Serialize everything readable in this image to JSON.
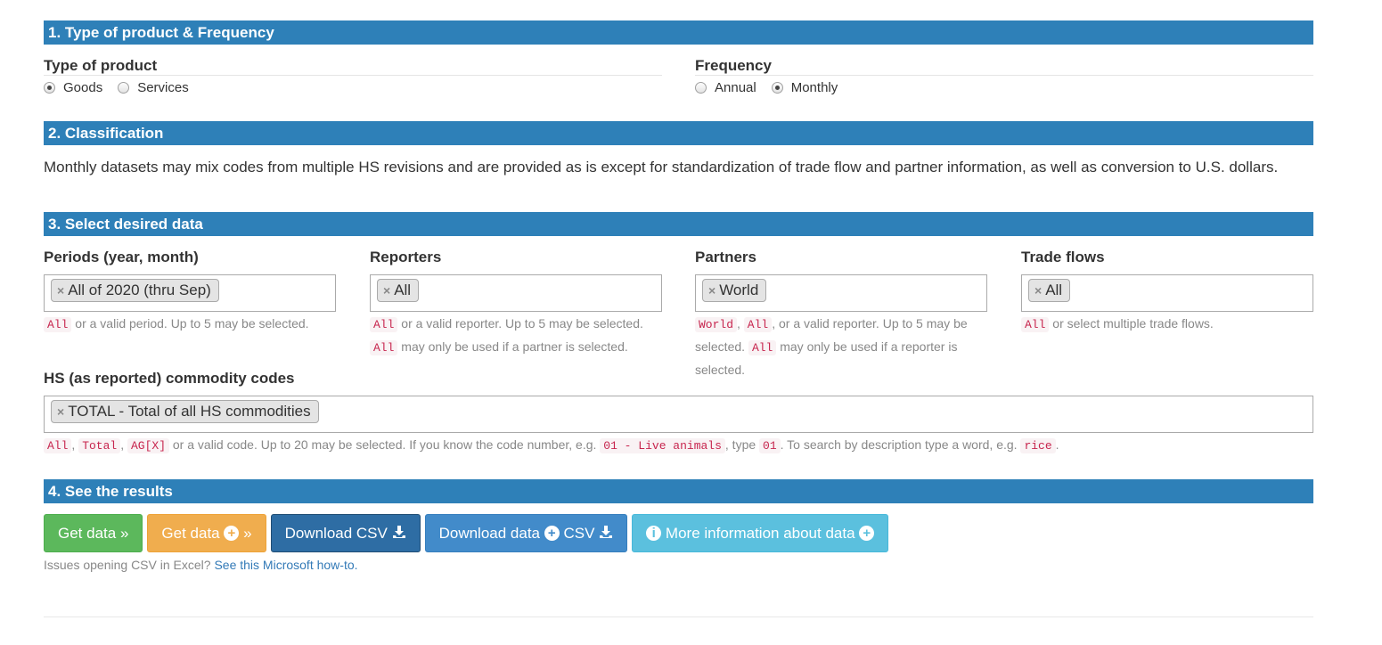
{
  "sections": {
    "s1": "1. Type of product & Frequency",
    "s2": "2. Classification",
    "s3": "3. Select desired data",
    "s4": "4. See the results"
  },
  "product_type": {
    "title": "Type of product",
    "options": [
      {
        "label": "Goods",
        "checked": true
      },
      {
        "label": "Services",
        "checked": false
      }
    ]
  },
  "frequency": {
    "title": "Frequency",
    "options": [
      {
        "label": "Annual",
        "checked": false
      },
      {
        "label": "Monthly",
        "checked": true
      }
    ]
  },
  "classification": {
    "description": "Monthly datasets may mix codes from multiple HS revisions and are provided as is except for standardization of trade flow and partner information, as well as conversion to U.S. dollars."
  },
  "filters": {
    "periods": {
      "label": "Periods (year, month)",
      "tag": "All of 2020 (thru Sep)",
      "help": {
        "c1": "All",
        "t1": " or a valid period. Up to 5 may be selected."
      }
    },
    "reporters": {
      "label": "Reporters",
      "tag": "All",
      "help": {
        "c1": "All",
        "t1": " or a valid reporter. Up to 5 may be selected. ",
        "c2": "All",
        "t2": " may only be used if a partner is selected."
      }
    },
    "partners": {
      "label": "Partners",
      "tag": "World",
      "help": {
        "c1": "World",
        "s1": ", ",
        "c2": "All",
        "t1": ", or a valid reporter. Up to 5 may be selected. ",
        "c3": "All",
        "t2": " may only be used if a reporter is selected."
      }
    },
    "trade_flows": {
      "label": "Trade flows",
      "tag": "All",
      "help": {
        "c1": "All",
        "t1": " or select multiple trade flows."
      }
    }
  },
  "hs": {
    "label": "HS (as reported) commodity codes",
    "tag": "TOTAL - Total of all HS commodities",
    "help": {
      "c1": "All",
      "s1": ", ",
      "c2": "Total",
      "s2": ", ",
      "c3": "AG[X]",
      "t1": " or a valid code. Up to 20 may be selected. If you know the code number, e.g. ",
      "c4": "01 - Live animals",
      "t2": ", type ",
      "c5": "01",
      "t3": ". To search by description type a word, e.g. ",
      "c6": "rice",
      "t4": "."
    }
  },
  "results": {
    "get_data": "Get data",
    "get_data_plus": "Get data",
    "download_csv": "Download CSV",
    "download_data": "Download data",
    "csv": "CSV",
    "more_info": "More information about data",
    "note_text": "Issues opening CSV in Excel? ",
    "note_link": "See this Microsoft how-to."
  },
  "colors": {
    "header_bg": "#2e80b8",
    "success": "#5cb85c",
    "warning": "#f0ad4e",
    "primary_dark": "#2e6da4",
    "primary": "#428bca",
    "info": "#5bc0de",
    "code": "#c7254e"
  },
  "icons": [
    "remove-icon",
    "double-chevron-right-icon",
    "plus-circle-icon",
    "download-icon",
    "info-circle-icon"
  ]
}
